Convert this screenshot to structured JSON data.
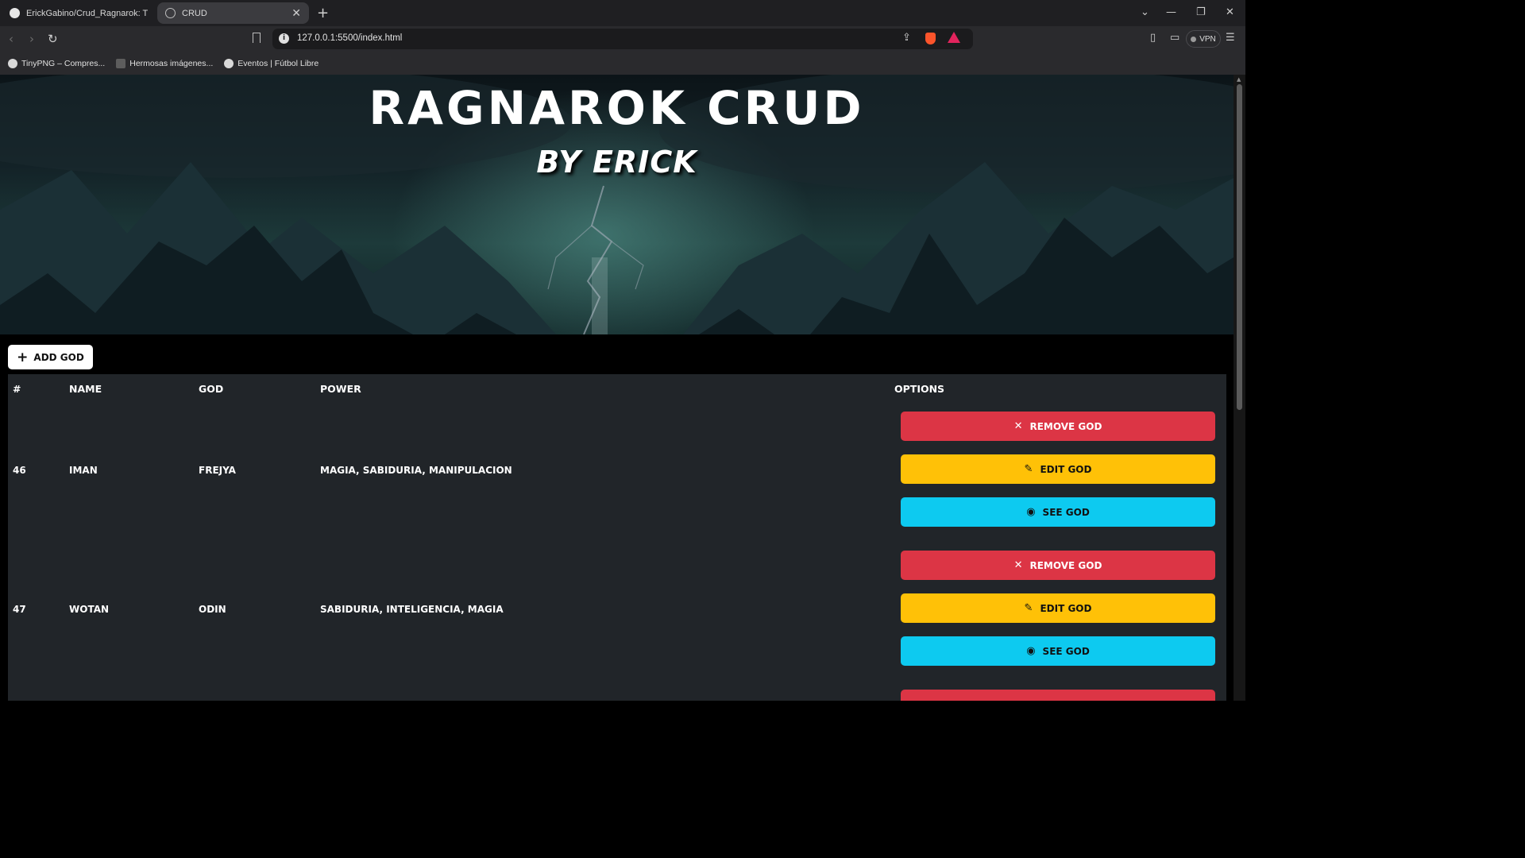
{
  "browser": {
    "tabs": [
      {
        "title": "ErickGabino/Crud_Ragnarok: This is"
      },
      {
        "title": "CRUD"
      }
    ],
    "url": "127.0.0.1:5500/index.html",
    "vpn_label": "VPN",
    "bookmarks": [
      {
        "label": "TinyPNG – Compres..."
      },
      {
        "label": "Hermosas imágenes..."
      },
      {
        "label": "Eventos | Fútbol Libre"
      }
    ]
  },
  "hero": {
    "title": "RAGNAROK CRUD",
    "subtitle": "BY ERICK"
  },
  "actions": {
    "add_label": "ADD GOD"
  },
  "table": {
    "headers": {
      "id": "#",
      "name": "NAME",
      "god": "GOD",
      "power": "POWER",
      "options": "OPTIONS"
    },
    "rows": [
      {
        "id": "46",
        "name": "IMAN",
        "god": "FREJYA",
        "power": "MAGIA, SABIDURIA, MANIPULACION"
      },
      {
        "id": "47",
        "name": "WOTAN",
        "god": "ODIN",
        "power": "SABIDURIA, INTELIGENCIA, MAGIA"
      }
    ],
    "buttons": {
      "remove": "REMOVE GOD",
      "edit": "EDIT GOD",
      "see": "SEE GOD"
    }
  },
  "colors": {
    "remove": "#dc3545",
    "edit": "#ffc107",
    "see": "#0dcaf0",
    "table_bg": "#212529"
  },
  "icons": {
    "remove": "close-icon",
    "edit": "pencil-icon",
    "see": "eye-icon",
    "add": "plus-icon"
  }
}
